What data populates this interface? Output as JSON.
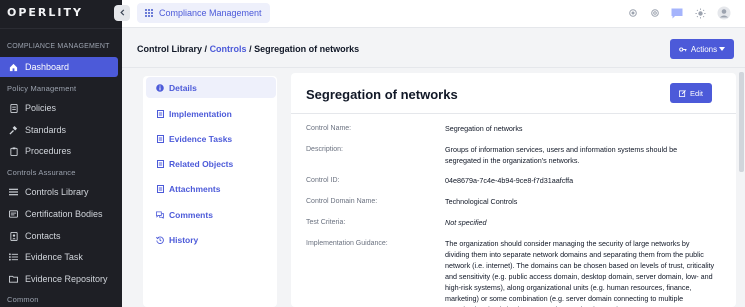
{
  "app": {
    "logo": "OPERLITY",
    "title": "Compliance Management"
  },
  "sidebar": {
    "section_compliance": "COMPLIANCE MANAGEMENT",
    "dashboard": "Dashboard",
    "section_policy": "Policy Management",
    "policies": "Policies",
    "standards": "Standards",
    "procedures": "Procedures",
    "section_controls": "Controls Assurance",
    "controls_library": "Controls Library",
    "certification_bodies": "Certification Bodies",
    "contacts": "Contacts",
    "evidence_task": "Evidence Task",
    "evidence_repository": "Evidence Repository",
    "section_common": "Common"
  },
  "breadcrumb": {
    "root": "Control Library",
    "sep1": "/",
    "controls": "Controls",
    "sep2": "/",
    "current": "Segregation of networks"
  },
  "actions_label": "Actions",
  "tabs": {
    "details": "Details",
    "implementation": "Implementation",
    "evidence_tasks": "Evidence Tasks",
    "related_objects": "Related Objects",
    "attachments": "Attachments",
    "comments": "Comments",
    "history": "History"
  },
  "card": {
    "title": "Segregation of networks",
    "edit_label": "Edit"
  },
  "fields": {
    "control_name": {
      "label": "Control Name:",
      "value": "Segregation of networks"
    },
    "description": {
      "label": "Description:",
      "value": "Groups of information services, users and information systems should be segregated in the organization's networks."
    },
    "control_id": {
      "label": "Control ID:",
      "value": "04e8679a-7c4e-4b94-9ce8-f7d31aafcffa"
    },
    "control_domain": {
      "label": "Control Domain Name:",
      "value": "Technological Controls"
    },
    "test_criteria": {
      "label": "Test Criteria:",
      "value": "Not specified"
    },
    "implementation_guidance": {
      "label": "Implementation Guidance:",
      "value": "The organization should consider managing the security of large networks by dividing them into separate network domains and separating them from the public network (i.e. internet). The domains can be chosen based on levels of trust, criticality and sensitivity (e.g. public access domain, desktop domain, server domain, low- and high-risk systems), along organizational units (e.g. human resources, finance, marketing) or some combination (e.g. server domain connecting to multiple organizational units). The segregation can be done using"
    }
  },
  "colors": {
    "accent": "#4c5ad9",
    "sidebar_bg": "#1e1f25"
  }
}
